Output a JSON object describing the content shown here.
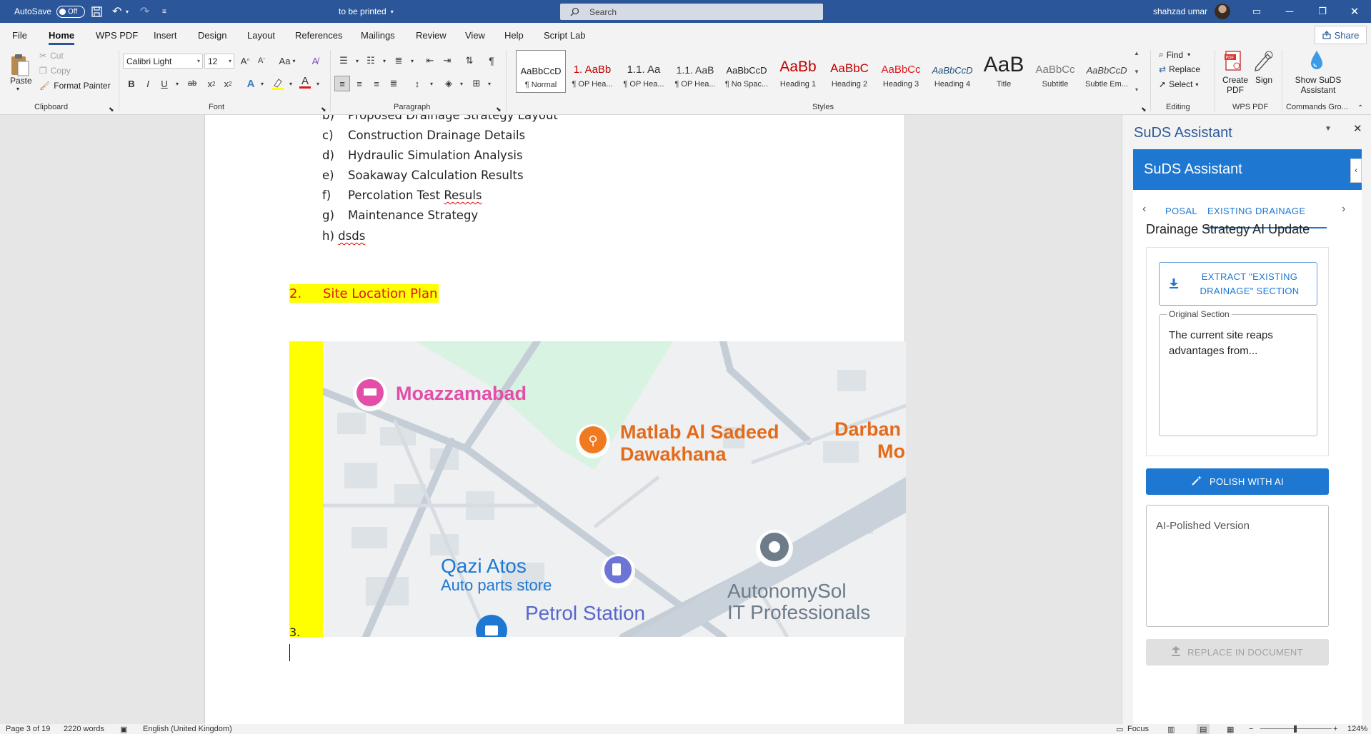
{
  "titlebar": {
    "autosave_label": "AutoSave",
    "autosave_state": "Off",
    "doc_title": "to be printed",
    "search_placeholder": "Search",
    "user_name": "shahzad umar"
  },
  "menu": {
    "items": [
      "File",
      "Home",
      "WPS PDF",
      "Insert",
      "Design",
      "Layout",
      "References",
      "Mailings",
      "Review",
      "View",
      "Help",
      "Script Lab"
    ],
    "share": "Share"
  },
  "ribbon": {
    "clipboard": {
      "paste": "Paste",
      "cut": "Cut",
      "copy": "Copy",
      "format_painter": "Format Painter",
      "group": "Clipboard"
    },
    "font": {
      "name": "Calibri Light",
      "size": "12",
      "group": "Font",
      "case_btn": "Aa",
      "grow": "A",
      "bold": "B",
      "italic": "I",
      "underline": "U",
      "strike": "ab",
      "sub": "x",
      "sup": "x",
      "color_a": "A"
    },
    "paragraph": {
      "group": "Paragraph"
    },
    "styles": {
      "group": "Styles",
      "items": [
        {
          "preview": "AaBbCcD",
          "name": "¶ Normal"
        },
        {
          "preview": "1. AaBb",
          "name": "¶ OP Hea..."
        },
        {
          "preview": "1.1. Aa",
          "name": "¶ OP Hea..."
        },
        {
          "preview": "1.1. AaB",
          "name": "¶ OP Hea..."
        },
        {
          "preview": "AaBbCcD",
          "name": "¶ No Spac..."
        },
        {
          "preview": "AaBb",
          "name": "Heading 1"
        },
        {
          "preview": "AaBbC",
          "name": "Heading 2"
        },
        {
          "preview": "AaBbCc",
          "name": "Heading 3"
        },
        {
          "preview": "AaBbCcD",
          "name": "Heading 4"
        },
        {
          "preview": "AaB",
          "name": "Title"
        },
        {
          "preview": "AaBbCc",
          "name": "Subtitle"
        },
        {
          "preview": "AaBbCcD",
          "name": "Subtle Em..."
        }
      ]
    },
    "editing": {
      "find": "Find",
      "replace": "Replace",
      "select": "Select",
      "group": "Editing"
    },
    "wps": {
      "create_pdf_1": "Create",
      "create_pdf_2": "PDF",
      "sign": "Sign",
      "group": "WPS PDF"
    },
    "commands": {
      "show_1": "Show SuDS",
      "show_2": "Assistant",
      "group": "Commands Gro..."
    }
  },
  "document": {
    "list": [
      {
        "k": "b)",
        "t": "Proposed Drainage Strategy Layout"
      },
      {
        "k": "c)",
        "t": "Construction Drainage Details"
      },
      {
        "k": "d)",
        "t": "Hydraulic Simulation Analysis"
      },
      {
        "k": "e)",
        "t": "Soakaway Calculation Results"
      },
      {
        "k": "f)",
        "t": "Percolation Test "
      },
      {
        "k": "g)",
        "t": "Maintenance Strategy"
      }
    ],
    "list_f_word": "Resuls",
    "item_h_key": "h)",
    "item_h_text": "dsds",
    "heading_num": "2.",
    "heading_text": "Site Location Plan",
    "caption": "3.",
    "map": {
      "place1": "Moazzamabad",
      "place2_l1": "Matlab Al Sadeed",
      "place2_l2": "Dawakhana",
      "place3_l1": "Darban",
      "place3_l2": "Mo",
      "place4_l1": "Qazi Atos",
      "place4_l2": "Auto parts store",
      "place5": "Petrol Station",
      "place6_l1": "AutonomySol",
      "place6_l2": "IT Professionals"
    }
  },
  "pane": {
    "title": "SuDS Assistant",
    "addin_title": "SuDS Assistant",
    "tab_prev": "POSAL",
    "tab_active": "EXISTING DRAINAGE",
    "card_title": "Drainage Strategy AI Update",
    "extract_l1": "EXTRACT \"EXISTING",
    "extract_l2": "DRAINAGE\" SECTION",
    "original_label": "Original Section",
    "original_text": "The current site reaps advantages from...",
    "polish": "POLISH WITH AI",
    "polished_placeholder": "AI-Polished Version",
    "replace": "REPLACE IN DOCUMENT"
  },
  "status": {
    "page": "Page 3 of 19",
    "words": "2220 words",
    "language": "English (United Kingdom)",
    "focus": "Focus",
    "zoom": "124%"
  },
  "colors": {
    "title_bar": "#2b579a",
    "addin_blue": "#1e78d2",
    "highlight": "#ffff00",
    "heading_red": "#e0161b"
  }
}
